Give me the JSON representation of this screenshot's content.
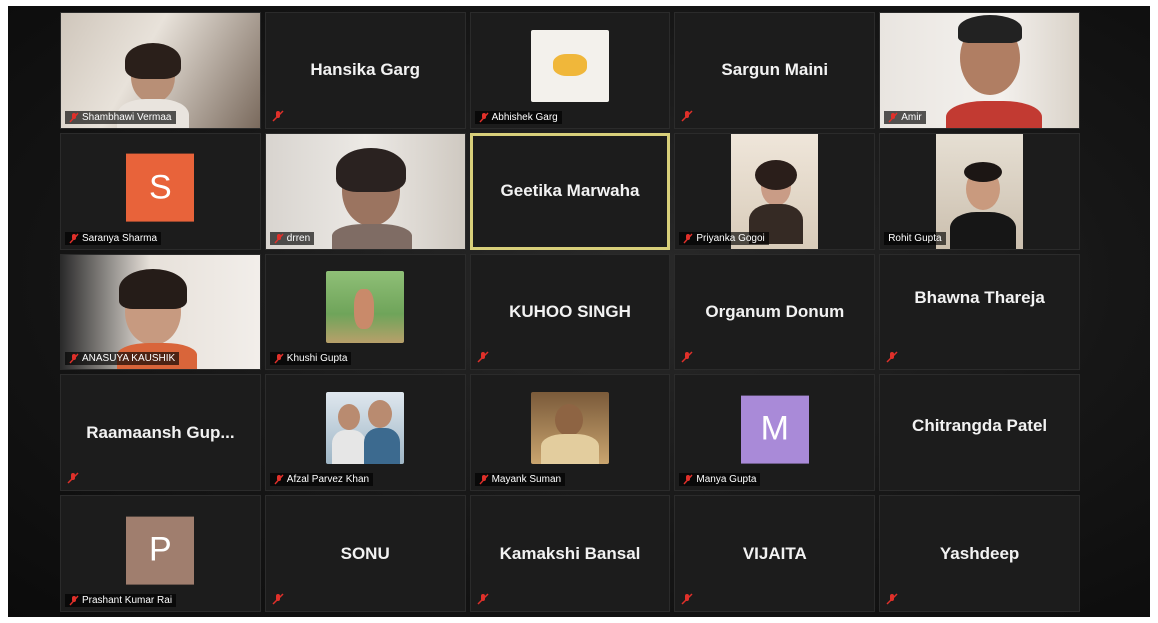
{
  "meeting": {
    "participants": [
      {
        "name": "Shambhawi Vermaa",
        "type": "video"
      },
      {
        "name": "Hansika Garg",
        "type": "name"
      },
      {
        "name": "Abhishek Garg",
        "type": "thumb"
      },
      {
        "name": "Sargun Maini",
        "type": "name"
      },
      {
        "name": "Amir",
        "type": "video"
      },
      {
        "name": "Saranya Sharma",
        "type": "avatar",
        "initial": "S",
        "color": "#e8633a"
      },
      {
        "name": "drren",
        "type": "video"
      },
      {
        "name": "Geetika Marwaha",
        "type": "name",
        "active": true
      },
      {
        "name": "Priyanka Gogoi",
        "type": "video"
      },
      {
        "name": "Rohit Gupta",
        "type": "video"
      },
      {
        "name": "ANASUYA KAUSHIK",
        "type": "video"
      },
      {
        "name": "Khushi Gupta",
        "type": "thumb"
      },
      {
        "name": "KUHOO SINGH",
        "type": "name"
      },
      {
        "name": "Organum Donum",
        "type": "name"
      },
      {
        "name": "Bhawna Thareja",
        "type": "name"
      },
      {
        "name": "Raamaansh Gup...",
        "type": "name"
      },
      {
        "name": "Afzal Parvez Khan",
        "type": "thumb"
      },
      {
        "name": "Mayank Suman",
        "type": "thumb"
      },
      {
        "name": "Manya Gupta",
        "type": "avatar",
        "initial": "M",
        "color": "#a98ad8"
      },
      {
        "name": "Chitrangda Patel",
        "type": "name"
      },
      {
        "name": "Prashant Kumar Rai",
        "type": "avatar",
        "initial": "P",
        "color": "#a07e6e"
      },
      {
        "name": "SONU",
        "type": "name"
      },
      {
        "name": "Kamakshi Bansal",
        "type": "name"
      },
      {
        "name": "VIJAITA",
        "type": "name"
      },
      {
        "name": "Yashdeep",
        "type": "name"
      }
    ],
    "colors": {
      "active_border": "#d8cf7a",
      "muted_icon": "#e0302a",
      "tile_bg": "#1c1c1c"
    }
  }
}
